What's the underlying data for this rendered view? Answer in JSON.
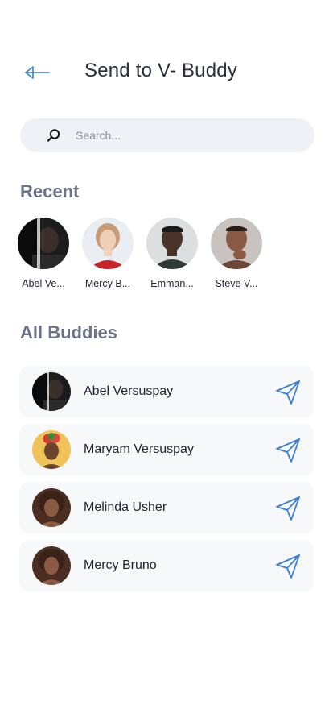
{
  "header": {
    "title": "Send to V- Buddy",
    "back_icon": "arrow-left-icon"
  },
  "search": {
    "placeholder": "Search...",
    "icon": "search-icon"
  },
  "recent": {
    "title": "Recent",
    "items": [
      {
        "label": "Abel Ve..."
      },
      {
        "label": "Mercy B..."
      },
      {
        "label": "Emman..."
      },
      {
        "label": "Steve V..."
      }
    ]
  },
  "buddies": {
    "title": "All Buddies",
    "items": [
      {
        "name": "Abel Versuspay"
      },
      {
        "name": "Maryam Versuspay"
      },
      {
        "name": "Melinda Usher"
      },
      {
        "name": "Mercy Bruno"
      }
    ]
  },
  "colors": {
    "accent": "#3b7fd0",
    "section_title": "#6b7389",
    "search_bg": "#eef1f6",
    "row_bg": "#f7f8fa"
  }
}
